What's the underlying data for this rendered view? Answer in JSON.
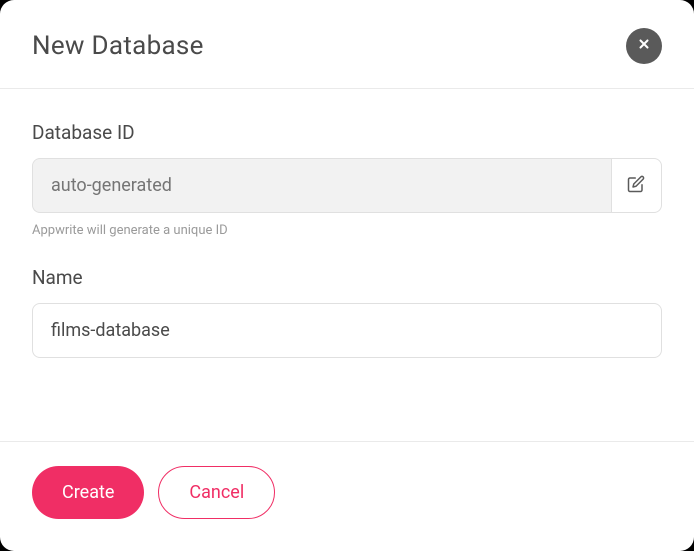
{
  "modal": {
    "title": "New Database",
    "fields": {
      "database_id": {
        "label": "Database ID",
        "placeholder": "auto-generated",
        "help": "Appwrite will generate a unique ID"
      },
      "name": {
        "label": "Name",
        "value": "films-database"
      }
    },
    "actions": {
      "create": "Create",
      "cancel": "Cancel"
    }
  }
}
